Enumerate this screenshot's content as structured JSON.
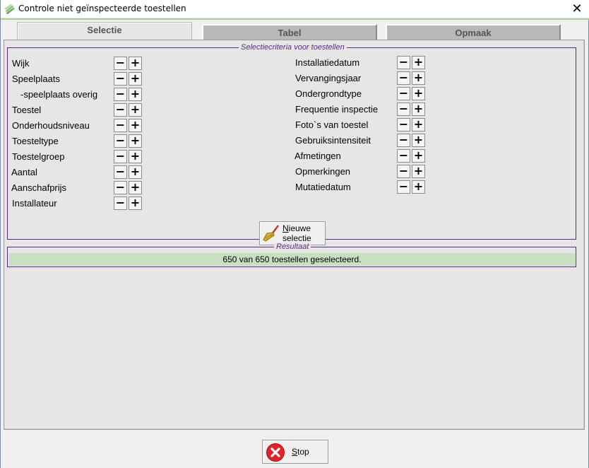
{
  "window": {
    "title": "Controle niet geïnspecteerde toestellen",
    "close_glyph": "✕"
  },
  "tabs": [
    {
      "label": "Selectie",
      "active": true
    },
    {
      "label": "Tabel",
      "active": false
    },
    {
      "label": "Opmaak",
      "active": false
    }
  ],
  "criteria": {
    "legend": "Selectiecriteria voor toestellen",
    "left": [
      {
        "label": "Wijk"
      },
      {
        "label": "Speelplaats"
      },
      {
        "label": "-speelplaats overig"
      },
      {
        "label": "Toestel"
      },
      {
        "label": "Onderhoudsniveau"
      },
      {
        "label": "Toesteltype"
      },
      {
        "label": "Toestelgroep"
      },
      {
        "label": "Aantal"
      },
      {
        "label": "Aanschafprijs"
      },
      {
        "label": "Installateur"
      }
    ],
    "right": [
      {
        "label": "Installatiedatum"
      },
      {
        "label": "Vervangingsjaar"
      },
      {
        "label": "Ondergrondtype"
      },
      {
        "label": "Frequentie inspectie"
      },
      {
        "label": "Foto`s van toestel"
      },
      {
        "label": "Gebruiksintensiteit"
      },
      {
        "label": "Afmetingen"
      },
      {
        "label": "Opmerkingen"
      },
      {
        "label": "Mutatiedatum"
      }
    ],
    "minus_glyph": "−",
    "plus_glyph": "+",
    "new_selection": {
      "line1_underlined": "N",
      "line1_rest": "ieuwe",
      "line2": "selectie",
      "icon": "broom-icon"
    }
  },
  "result": {
    "legend": "Resultaat",
    "text": "650 van 650 toestellen geselecteerd."
  },
  "stop_button": {
    "underlined": "S",
    "rest": "top",
    "icon": "stop-icon"
  },
  "colors": {
    "accent_green_line": "#a9cf9d",
    "result_bg": "#c6e0c0",
    "group_border": "#5a2a82",
    "stop_red": "#e0242a"
  }
}
